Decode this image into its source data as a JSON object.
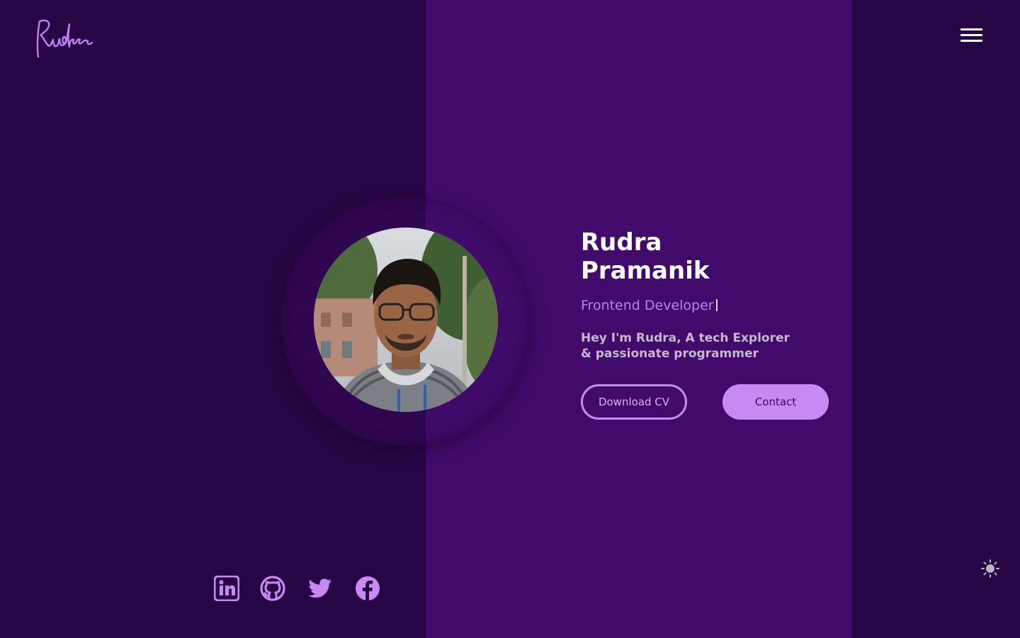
{
  "brand": {
    "logo_text": "Rudra"
  },
  "hero": {
    "name_first": "Rudra",
    "name_last": "Pramanik",
    "role": "Frontend Developer",
    "bio_line1": "Hey I'm Rudra, A tech Explorer",
    "bio_line2": "& passionate programmer",
    "download_cv_label": "Download CV",
    "contact_label": "Contact"
  },
  "socials": [
    {
      "icon": "linkedin-icon"
    },
    {
      "icon": "github-icon"
    },
    {
      "icon": "twitter-icon"
    },
    {
      "icon": "facebook-icon"
    }
  ],
  "icons": {
    "menu": "hamburger-menu-icon",
    "theme": "sun-icon"
  },
  "colors": {
    "background": "#280544",
    "center_band": "#420b6b",
    "accent": "#c78af2",
    "heading": "#ffffff",
    "body_text": "#c3b8cc"
  }
}
